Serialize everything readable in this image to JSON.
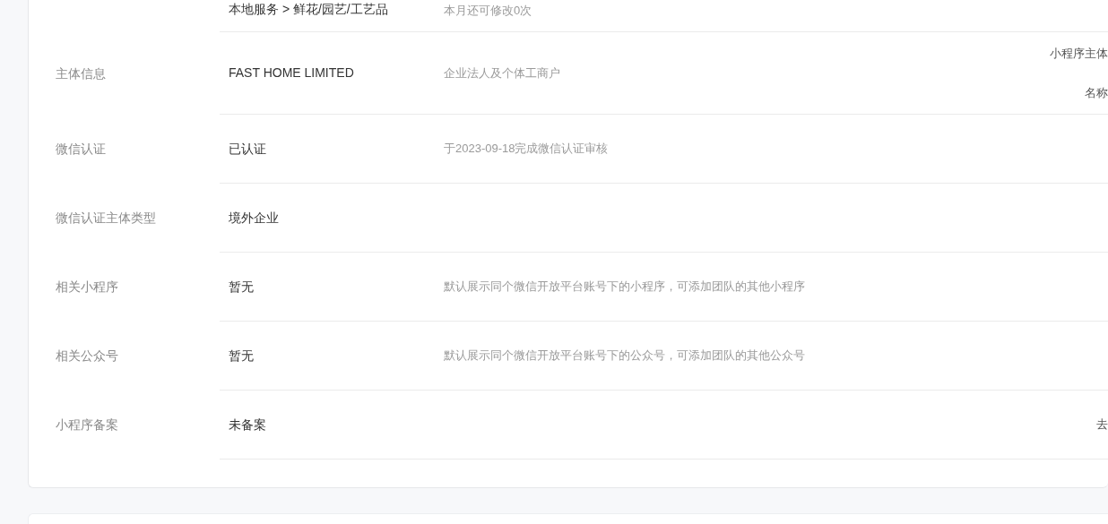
{
  "rows": [
    {
      "label": null,
      "value": "本地服务 > 鲜花/园艺/工艺品",
      "description": "本月还可修改0次",
      "action": []
    },
    {
      "label": "主体信息",
      "value": "FAST HOME LIMITED",
      "description": "企业法人及个体工商户",
      "action": [
        "小程序主体",
        "名称"
      ]
    },
    {
      "label": "微信认证",
      "value": "已认证",
      "description": "于2023-09-18完成微信认证审核",
      "action": []
    },
    {
      "label": "微信认证主体类型",
      "value": "境外企业",
      "description": null,
      "action": []
    },
    {
      "label": "相关小程序",
      "value": "暂无",
      "description": "默认展示同个微信开放平台账号下的小程序，可添加团队的其他小程序",
      "action": []
    },
    {
      "label": "相关公众号",
      "value": "暂无",
      "description": "默认展示同个微信开放平台账号下的公众号，可添加团队的其他公众号",
      "action": []
    },
    {
      "label": "小程序备案",
      "value": "未备案",
      "description": null,
      "action": [
        "去"
      ]
    }
  ]
}
